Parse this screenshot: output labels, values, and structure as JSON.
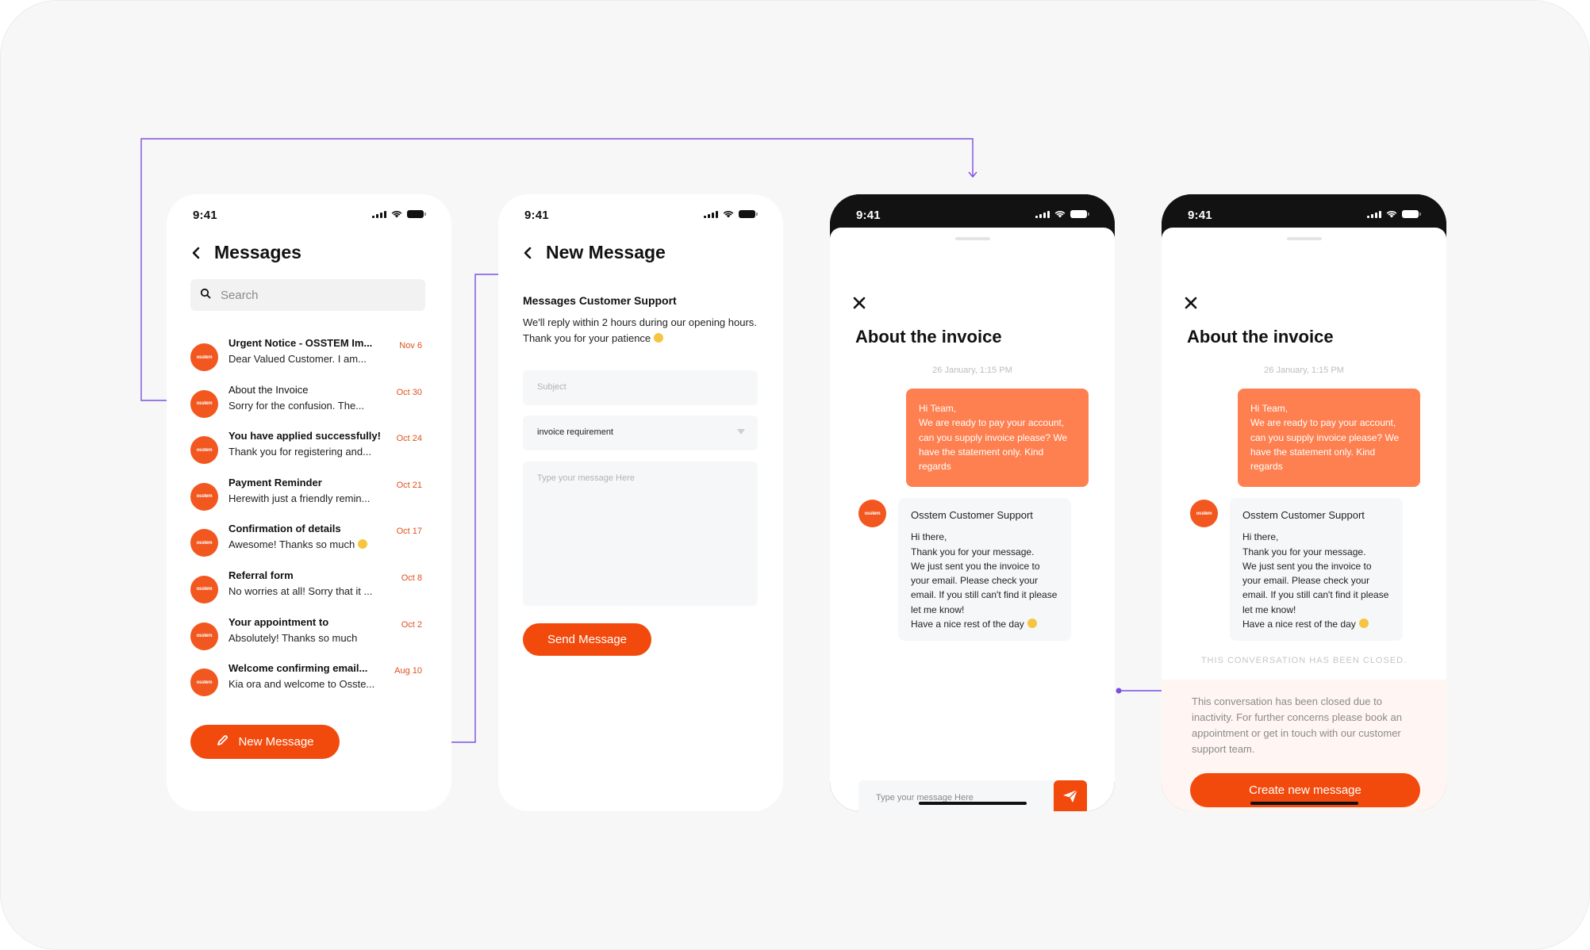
{
  "status_time": "9:41",
  "accent_color": "#f24a0c",
  "messages_screen": {
    "title": "Messages",
    "search_placeholder": "Search",
    "avatar_text": "osstem",
    "items": [
      {
        "title": "Urgent Notice - OSSTEM Im...",
        "preview": "Dear Valued Customer. I am...",
        "date": "Nov 6"
      },
      {
        "title": "About the Invoice",
        "preview": "Sorry for the confusion. The...",
        "date": "Oct 30"
      },
      {
        "title": "You have applied successfully!",
        "preview": "Thank you for registering and...",
        "date": "Oct 24"
      },
      {
        "title": "Payment Reminder",
        "preview": "Herewith just a friendly remin...",
        "date": "Oct 21"
      },
      {
        "title": "Confirmation of details",
        "preview": "Awesome! Thanks so much",
        "date": "Oct 17"
      },
      {
        "title": "Referral form",
        "preview": "No worries at all! Sorry that it ...",
        "date": "Oct 8"
      },
      {
        "title": "Your appointment to",
        "preview": "Absolutely! Thanks so much",
        "date": "Oct 2"
      },
      {
        "title": "Welcome confirming email...",
        "preview": "Kia ora and welcome to Osste...",
        "date": "Aug 10"
      }
    ],
    "new_message_button": "New Message"
  },
  "new_message_screen": {
    "title": "New Message",
    "heading": "Messages Customer Support",
    "description": "We'll reply within 2 hours during our opening hours. Thank you for your patience",
    "subject_placeholder": "Subject",
    "category_value": "invoice requirement",
    "body_placeholder": "Type your message Here",
    "send_button": "Send Message"
  },
  "chat_screen": {
    "title": "About the invoice",
    "date": "26 January, 1:15 PM",
    "outgoing_message": "Hi Team,\nWe are ready to pay your account, can you supply invoice please? We have the statement only. Kind regards",
    "agent_name": "Osstem Customer Support",
    "incoming_message": "Hi there,\nThank you for your message.\nWe just sent you the invoice to your email. Please check your email. If you still can't find it please let me know!\nHave a nice rest of the day",
    "input_placeholder": "Type your message Here"
  },
  "closed_screen": {
    "closed_label": "THIS CONVERSATION HAS BEEN CLOSED.",
    "closed_text": "This conversation has been closed due to inactivity. For further concerns please book an appointment or get in touch with our customer support team.",
    "create_button": "Create new message"
  }
}
